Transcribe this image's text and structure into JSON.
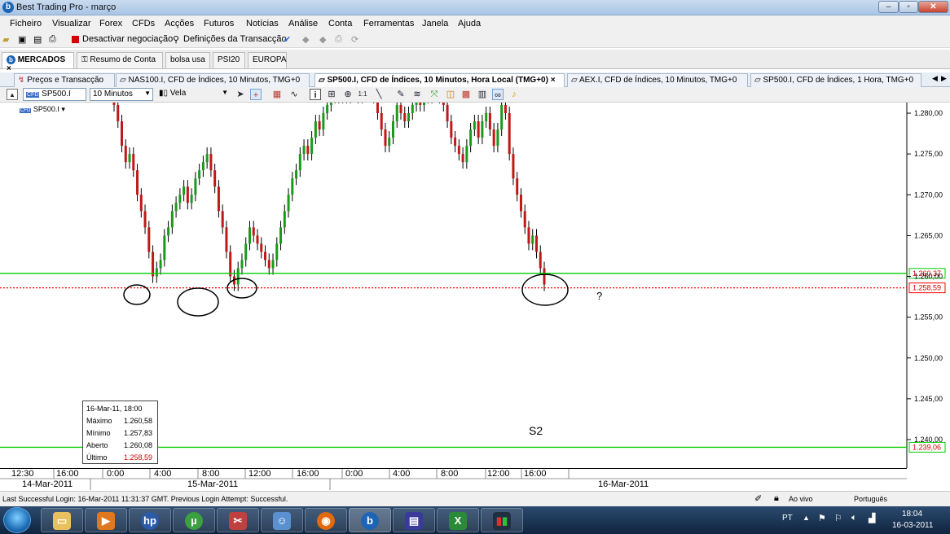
{
  "window": {
    "title": "Best Trading Pro - março",
    "controls": [
      "–",
      "▫",
      "✕"
    ]
  },
  "menu": [
    "Ficheiro",
    "Visualizar",
    "Forex",
    "CFDs",
    "Acções",
    "Futuros",
    "Notícias",
    "Análise",
    "Conta",
    "Ferramentas",
    "Janela",
    "Ajuda"
  ],
  "toolbar": {
    "deactivate_label": "Desactivar negociação",
    "settings_label": "Definições da Transacção"
  },
  "workspace_tabs": [
    {
      "label": "MERCADOS",
      "active": true
    },
    {
      "label": "Resumo de Conta",
      "active": false
    },
    {
      "label": "bolsa usa",
      "active": false
    },
    {
      "label": "PSI20",
      "active": false
    },
    {
      "label": "EUROPA",
      "active": false
    }
  ],
  "chart_tabs": [
    {
      "label": "Preços e Transacção",
      "active": false
    },
    {
      "label": "NAS100.I, CFD de Índices, 10 Minutos, TMG+0",
      "active": false
    },
    {
      "label": "SP500.I, CFD de Índices, 10 Minutos, Hora Local (TMG+0)",
      "active": true
    },
    {
      "label": "AEX.I, CFD de Índices, 10 Minutos, TMG+0",
      "active": false
    },
    {
      "label": "SP500.I, CFD de Índices, 1 Hora, TMG+0",
      "active": false
    }
  ],
  "chart_toolbar": {
    "symbol": "SP500.I",
    "interval": "10 Minutos",
    "chart_type": "Vela"
  },
  "chart_data": {
    "type": "candlestick",
    "symbol_label": "SP500.I",
    "y_ticks": [
      "1.280,00",
      "1.275,00",
      "1.270,00",
      "1.265,00",
      "1.260,00",
      "1.255,00",
      "1.250,00",
      "1.245,00",
      "1.240,00"
    ],
    "ylim": [
      1238,
      1283
    ],
    "x_ticks": [
      "12:30",
      "16:00",
      "0:00",
      "4:00",
      "8:00",
      "12:00",
      "16:00",
      "0:00",
      "4:00",
      "8:00",
      "12:00",
      "16:00"
    ],
    "dates": [
      "14-Mar-2011",
      "15-Mar-2011",
      "16-Mar-2011"
    ],
    "horizontal_lines": [
      {
        "value": 1260.37,
        "label": "1.260,37",
        "color": "#00cc00",
        "style": "solid"
      },
      {
        "value": 1258.59,
        "label": "1.258,59",
        "color": "#ff0000",
        "style": "dotted"
      },
      {
        "value": 1239.06,
        "label": "1.239,06",
        "color": "#00cc00",
        "style": "solid"
      }
    ],
    "annotations": [
      "?",
      "S2"
    ],
    "closes": [
      1281,
      1279,
      1276,
      1274,
      1275,
      1273,
      1270,
      1268,
      1266,
      1263,
      1260,
      1261,
      1262,
      1265,
      1266,
      1268,
      1269,
      1270,
      1271,
      1269,
      1270,
      1272,
      1273,
      1274,
      1275,
      1273,
      1271,
      1268,
      1266,
      1263,
      1260,
      1259,
      1261,
      1262,
      1264,
      1266,
      1265,
      1264,
      1263,
      1262,
      1261,
      1262,
      1264,
      1266,
      1268,
      1270,
      1272,
      1273,
      1275,
      1276,
      1275,
      1277,
      1279,
      1278,
      1280,
      1281,
      1282,
      1283,
      1282,
      1283,
      1282,
      1283,
      1283,
      1282,
      1283,
      1283,
      1283,
      1282,
      1280,
      1278,
      1276,
      1277,
      1279,
      1281,
      1280,
      1279,
      1280,
      1281,
      1282,
      1281,
      1283,
      1282,
      1283,
      1283,
      1282,
      1281,
      1279,
      1277,
      1276,
      1275,
      1274,
      1276,
      1278,
      1279,
      1277,
      1279,
      1280,
      1278,
      1276,
      1278,
      1281,
      1280,
      1275,
      1272,
      1270,
      1268,
      1266,
      1264,
      1265,
      1263,
      1261,
      1259
    ]
  },
  "info_box": {
    "date": "16-Mar-11, 18:00",
    "rows": [
      {
        "label": "Máximo",
        "value": "1.260,58"
      },
      {
        "label": "Mínimo",
        "value": "1.257,83"
      },
      {
        "label": "Aberto",
        "value": "1.260,08"
      },
      {
        "label": "Último",
        "value": "1.258,59"
      }
    ]
  },
  "status": {
    "login_text": "Last Successful Login: 16-Mar-2011 11:31:37 GMT. Previous Login Attempt: Successful.",
    "live_label": "Ao vivo",
    "language": "Português"
  },
  "taskbar": {
    "lang": "PT",
    "time": "18:04",
    "date": "16-03-2011"
  }
}
